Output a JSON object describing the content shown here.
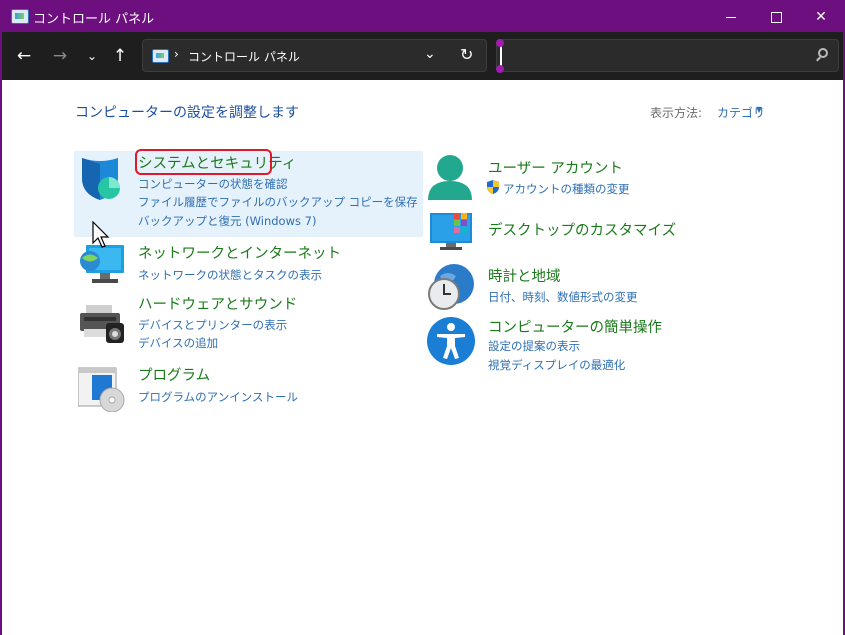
{
  "window": {
    "title": "コントロール パネル"
  },
  "navbar": {
    "address_text": "コントロール パネル",
    "search_placeholder": ""
  },
  "page": {
    "heading": "コンピューターの設定を調整します",
    "view_by_label": "表示方法:",
    "view_by_value": "カテゴリ"
  },
  "categories": {
    "system_security": {
      "title": "システムとセキュリティ",
      "links": [
        "コンピューターの状態を確認",
        "ファイル履歴でファイルのバックアップ コピーを保存",
        "バックアップと復元 (Windows 7)"
      ]
    },
    "network": {
      "title": "ネットワークとインターネット",
      "links": [
        "ネットワークの状態とタスクの表示"
      ]
    },
    "hardware": {
      "title": "ハードウェアとサウンド",
      "links": [
        "デバイスとプリンターの表示",
        "デバイスの追加"
      ]
    },
    "programs": {
      "title": "プログラム",
      "links": [
        "プログラムのアンインストール"
      ]
    },
    "user_accounts": {
      "title": "ユーザー アカウント",
      "links": [
        "アカウントの種類の変更"
      ]
    },
    "appearance": {
      "title": "デスクトップのカスタマイズ",
      "links": []
    },
    "clock_region": {
      "title": "時計と地域",
      "links": [
        "日付、時刻、数値形式の変更"
      ]
    },
    "ease_of_access": {
      "title": "コンピューターの簡単操作",
      "links": [
        "設定の提案の表示",
        "視覚ディスプレイの最適化"
      ]
    }
  },
  "colors": {
    "titlebar": "#6d0f7e",
    "category_title": "#1a7a1a",
    "link": "#2f6fb4",
    "highlight": "#e5f1fb",
    "outline": "#e0192a"
  }
}
